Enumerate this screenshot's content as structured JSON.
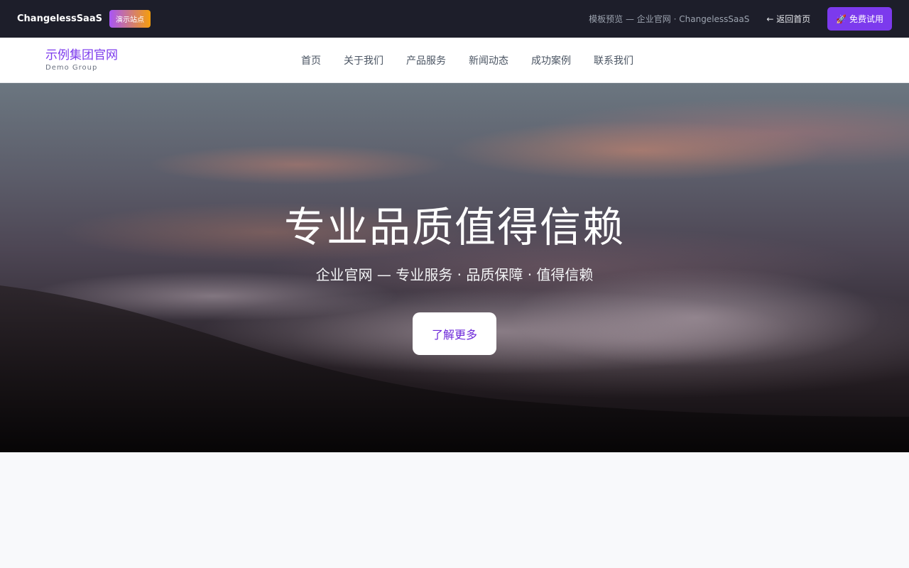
{
  "topbar": {
    "brand": "ChangelessSaaS",
    "badge": "演示站点",
    "crumb": "模板预览 — 企业官网 · ChangelessSaaS",
    "back_label": "← 返回首页",
    "cta_label": "🚀 免费试用"
  },
  "nav": {
    "logo_name": "示例集团官网",
    "logo_sub": "Demo Group",
    "links": [
      "首页",
      "关于我们",
      "产品服务",
      "新闻动态",
      "成功案例",
      "联系我们"
    ]
  },
  "hero": {
    "title": "专业品质值得信赖",
    "subtitle": "企业官网 — 专业服务 · 品质保障 · 值得信赖",
    "button_label": "了解更多"
  },
  "colors": {
    "accent": "#7c3aed",
    "topbar_bg": "#1d1e2a",
    "hero_button_text": "#6d28d9"
  }
}
